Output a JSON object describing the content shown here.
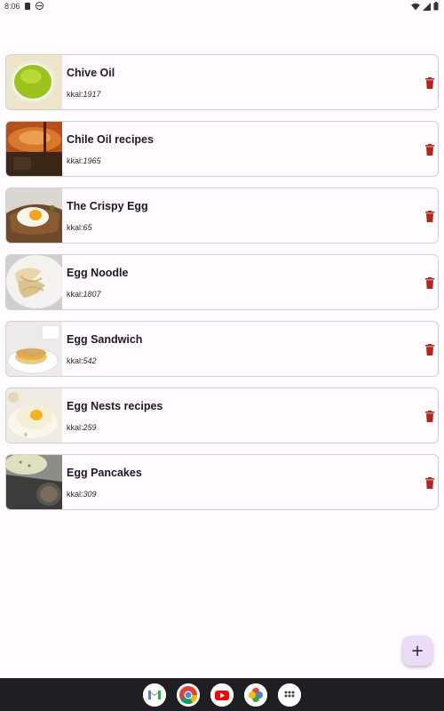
{
  "status_bar": {
    "time": "8:06"
  },
  "recipes": [
    {
      "title": "Chive Oil",
      "kcal_label": "kkal:",
      "kcal": "1917",
      "image": "chive-oil-photo"
    },
    {
      "title": "Chile Oil recipes",
      "kcal_label": "kkal:",
      "kcal": "1965",
      "image": "chile-oil-photo"
    },
    {
      "title": "The Crispy Egg",
      "kcal_label": "kkal:",
      "kcal": "65",
      "image": "crispy-egg-photo"
    },
    {
      "title": "Egg Noodle",
      "kcal_label": "kkal:",
      "kcal": "1807",
      "image": "egg-noodle-photo"
    },
    {
      "title": "Egg Sandwich",
      "kcal_label": "kkal:",
      "kcal": "542",
      "image": "egg-sandwich-photo"
    },
    {
      "title": "Egg Nests recipes",
      "kcal_label": "kkal:",
      "kcal": "259",
      "image": "egg-nests-photo"
    },
    {
      "title": "Egg Pancakes",
      "kcal_label": "kkal:",
      "kcal": "309",
      "image": "egg-pancakes-photo"
    }
  ],
  "fab": {
    "label": "+"
  },
  "colors": {
    "delete": "#b3261e",
    "fab_bg": "#eadcf7",
    "dock_bg": "#1f1f23"
  },
  "dock_apps": [
    "gmail-icon",
    "chrome-icon",
    "youtube-icon",
    "photos-icon",
    "app-drawer-icon"
  ]
}
